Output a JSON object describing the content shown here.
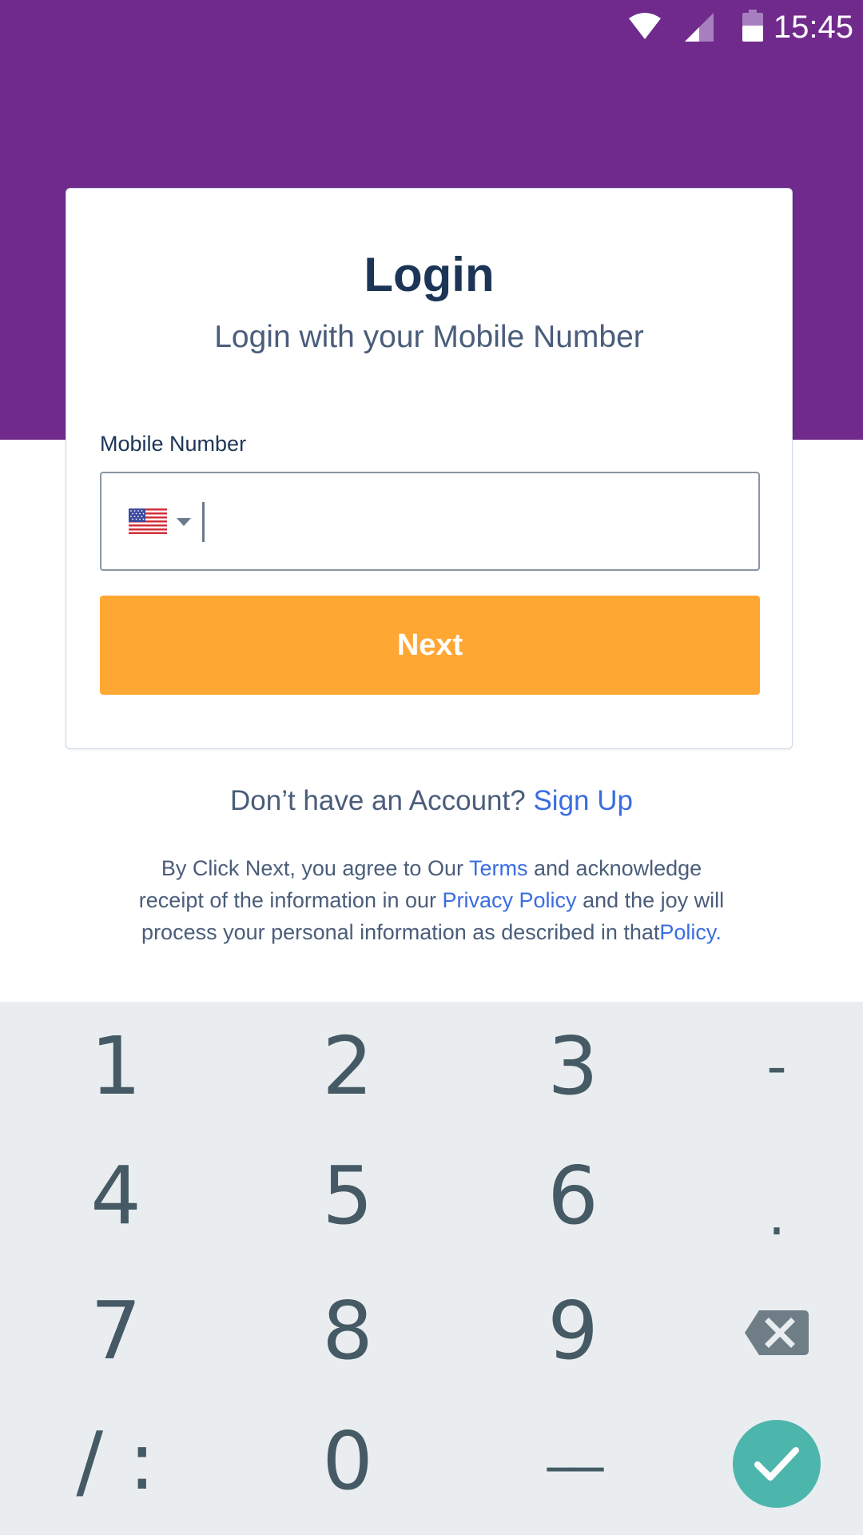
{
  "status_bar": {
    "time": "15:45",
    "icons": [
      "wifi-icon",
      "cellular-signal-icon",
      "battery-icon"
    ]
  },
  "colors": {
    "header_purple": "#702a8c",
    "title_navy": "#1c3557",
    "text_slate": "#4a5d7a",
    "link_blue": "#3a6de0",
    "next_orange": "#ffa733",
    "keypad_bg": "#e9edf0",
    "key_text": "#455a64",
    "done_teal": "#4db6ac"
  },
  "login_card": {
    "title": "Login",
    "subtitle": "Login with your Mobile Number",
    "mobile_label": "Mobile Number",
    "country_flag": "us-flag-icon",
    "phone_value": "",
    "next_label": "Next"
  },
  "signup": {
    "prompt": "Don’t have an Account?",
    "link": "Sign Up"
  },
  "legal": {
    "part1": "By Click Next, you agree to Our",
    "terms_link": "Terms",
    "part2": "and acknowledge receipt of the information in our",
    "privacy_link": "Privacy Policy",
    "part3": "and the joy will process your personal information as described in that",
    "policy_link": "Policy",
    "part4": "."
  },
  "keypad": {
    "k1": "1",
    "k2": "2",
    "k3": "3",
    "k_dash": "-",
    "k4": "4",
    "k5": "5",
    "k6": "6",
    "k_dot": ".",
    "k7": "7",
    "k8": "8",
    "k9": "9",
    "k_slash_colon": "/ :",
    "k0": "0",
    "k_underscore": "__",
    "backspace_icon": "backspace-icon",
    "done_icon": "checkmark-icon"
  }
}
